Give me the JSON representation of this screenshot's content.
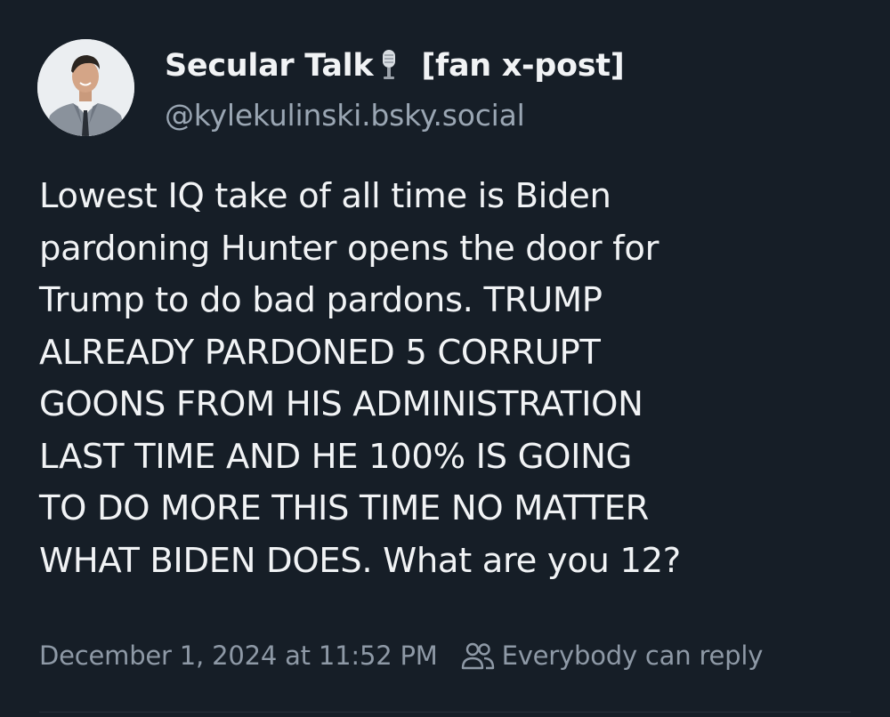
{
  "post": {
    "author": {
      "display_name": "Secular Talk",
      "display_name_suffix": "[fan x-post]",
      "name_emoji_icon": "microphone-icon",
      "handle": "@kylekulinski.bsky.social"
    },
    "text": "Lowest IQ take of all time is Biden\npardoning Hunter opens the door for\nTrump to do bad pardons. TRUMP\nALREADY PARDONED 5 CORRUPT\nGOONS FROM HIS ADMINISTRATION\nLAST TIME AND HE 100% IS GOING\nTO DO MORE THIS TIME NO MATTER\nWHAT BIDEN DOES. What are you 12?",
    "timestamp": "December 1, 2024 at 11:52 PM",
    "reply_setting": {
      "icon": "people-icon",
      "label": "Everybody can reply"
    }
  },
  "colors": {
    "background": "#161e27",
    "text_primary": "#f1f3f5",
    "text_secondary": "#9aa6b3"
  }
}
